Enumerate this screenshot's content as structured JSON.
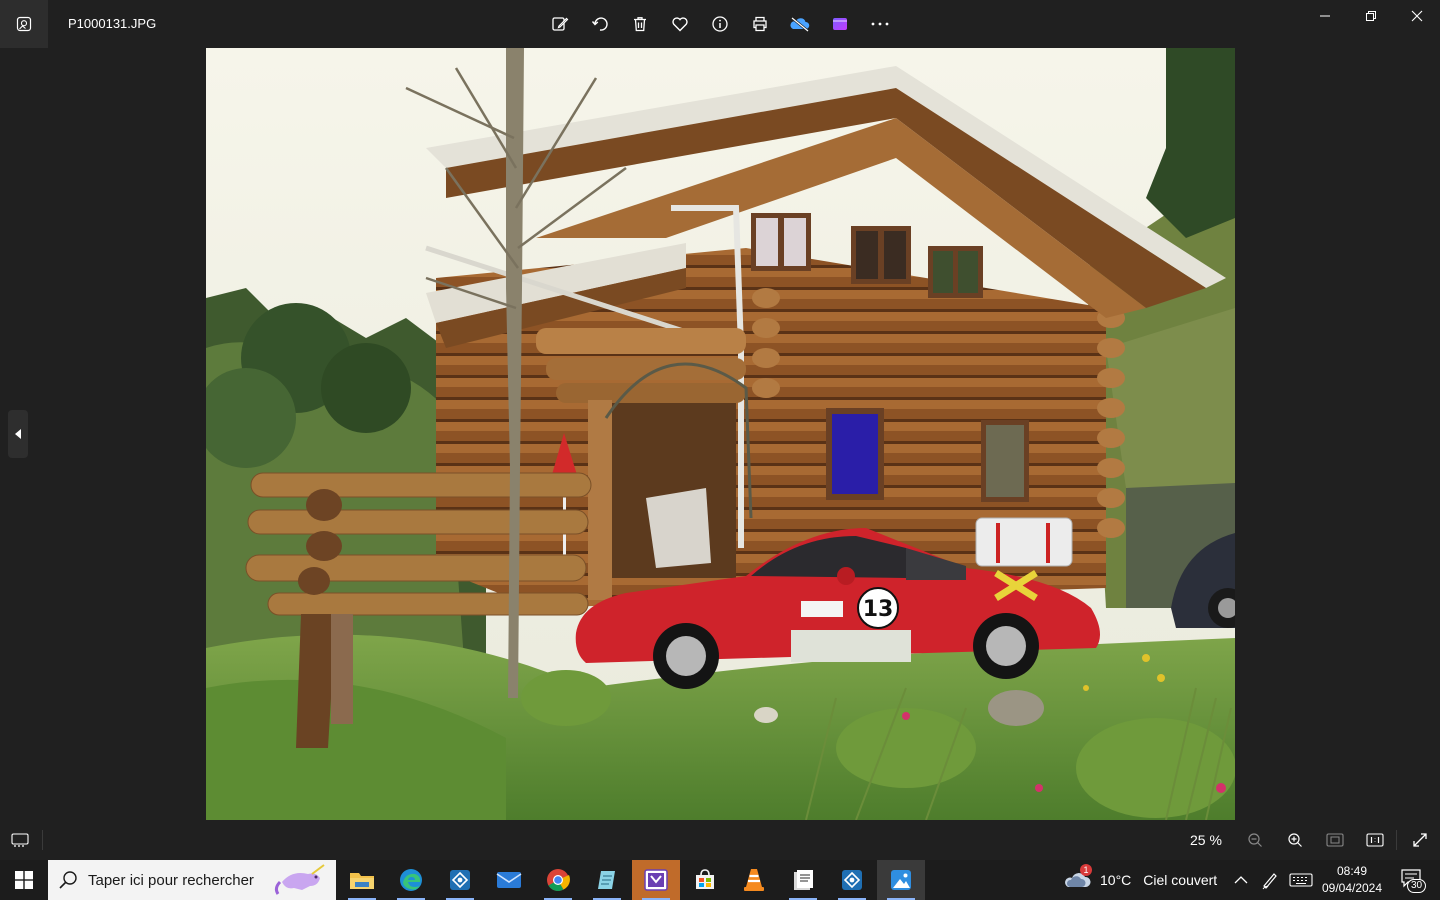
{
  "window": {
    "filename": "P1000131.JPG",
    "toolbar": [
      "edit-image-icon",
      "rotate-icon",
      "delete-icon",
      "favorite-icon",
      "info-icon",
      "print-icon",
      "onedrive-icon",
      "clipchamp-icon",
      "more-icon"
    ]
  },
  "viewer": {
    "zoom": "25 %",
    "bottom_icons": [
      "filmstrip-icon",
      "zoom-out-icon",
      "zoom-in-icon",
      "fit-window-icon",
      "actual-size-icon",
      "fullscreen-icon"
    ]
  },
  "taskbar": {
    "search_placeholder": "Taper ici pour rechercher",
    "apps": [
      "file-explorer",
      "edge",
      "app-blue",
      "mail",
      "chrome",
      "notepad-app",
      "active-app",
      "store",
      "vlc",
      "docs-app",
      "app-blue-2",
      "photos"
    ],
    "weather": {
      "temp": "10°C",
      "condition": "Ciel couvert",
      "badge": "1"
    },
    "time": "08:49",
    "date": "09/04/2024",
    "notifications": "30"
  },
  "colors": {
    "accent": "#8ab4f8",
    "car_red": "#d0232a",
    "wood": "#8a5224"
  }
}
